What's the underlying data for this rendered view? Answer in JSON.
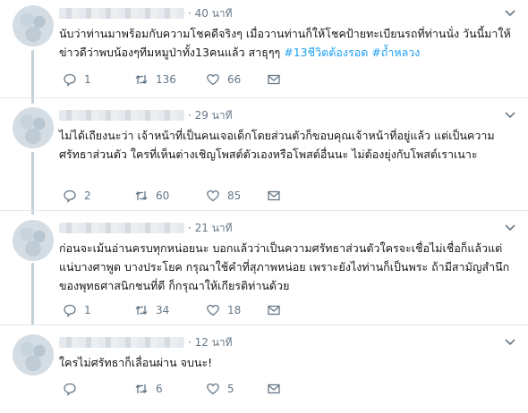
{
  "tweets": [
    {
      "time": "· 40 นาที",
      "text": "นับว่าท่านมาพร้อมกับความโชคดีจริงๆ เมื่อวานท่านก็ให้โชคป้ายทะเบียนรถที่ท่านนั่ง วันนี้มาให้ข่าวดีว่าพบน้องๆทีมหมูป่าทั้ง13คนแล้ว สาธุๆๆ",
      "hashtags": [
        "#13ชีวิตต้องรอด",
        "#ถ้ำหลวง"
      ],
      "replies": "1",
      "retweets": "136",
      "likes": "66"
    },
    {
      "time": "· 29 นาที",
      "text": "ไม่ได้เถียงนะว่า เจ้าหน้าที่เป็นคนเจอเด็กโดยส่วนตัวก็ขอบคุณเจ้าหน้าที่อยู่แล้ว แต่เป็นความศรัทธาส่วนตัว ใครที่เห็นต่างเชิญโพสต์ตัวเองหรือโพสต์อื่นนะ ไม่ต้องยุ่งกับโพสต์เราเนาะ",
      "hashtags": [],
      "replies": "2",
      "retweets": "60",
      "likes": "85"
    },
    {
      "time": "· 21 นาที",
      "text": "ก่อนจะเม้นอ่านครบทุกหน่อยนะ บอกแล้วว่าเป็นความศรัทธาส่วนตัวใครจะเชื่อไม่เชื่อก็แล้วแต่ แน่บางศาพูด บางประโยค กรุณาใช้คำที่สุภาพหน่อย เพราะยังไงท่านก็เป็นพระ ถ้ามีสามัญสำนึกของพุทธศาสนิกชนที่ดี ก็กรุณาให้เกียรติท่านด้วย",
      "hashtags": [],
      "replies": "1",
      "retweets": "34",
      "likes": "18"
    },
    {
      "time": "· 12 นาที",
      "text": "ใครไม่ศรัทธาก็เลื่อนผ่าน จบนะ!",
      "hashtags": [],
      "replies": "",
      "retweets": "6",
      "likes": "5"
    }
  ],
  "colors": {
    "hashtag": "#1da1f2",
    "meta": "#657786",
    "thread_line": "#c4cfd6"
  },
  "icons": [
    "reply-icon",
    "retweet-icon",
    "like-icon",
    "message-icon",
    "chevron-down-icon"
  ]
}
